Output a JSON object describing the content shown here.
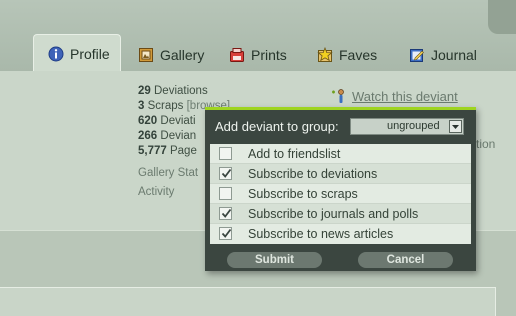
{
  "tabs": [
    {
      "label": "Profile",
      "icon": "info-icon",
      "active": true
    },
    {
      "label": "Gallery",
      "icon": "gallery-icon",
      "active": false
    },
    {
      "label": "Prints",
      "icon": "prints-icon",
      "active": false
    },
    {
      "label": "Faves",
      "icon": "faves-icon",
      "active": false
    },
    {
      "label": "Journal",
      "icon": "journal-icon",
      "active": false
    }
  ],
  "stats": [
    {
      "count": "29",
      "label": "Deviations"
    },
    {
      "count": "3",
      "label": "Scraps",
      "extra": "[browse]"
    },
    {
      "count": "620",
      "label": "Deviati"
    },
    {
      "count": "266",
      "label": "Devian"
    },
    {
      "count": "5,777",
      "label": "Page"
    }
  ],
  "meta": {
    "gallery": "Gallery Stat",
    "activity": "Activity"
  },
  "watch_link": "Watch this deviant",
  "right_partial": "tion",
  "popup": {
    "heading": "Add deviant to group:",
    "group_value": "ungrouped",
    "options": [
      {
        "label": "Add to friendslist",
        "checked": false
      },
      {
        "label": "Subscribe to deviations",
        "checked": true
      },
      {
        "label": "Subscribe to scraps",
        "checked": false
      },
      {
        "label": "Subscribe to journals and polls",
        "checked": true
      },
      {
        "label": "Subscribe to news articles",
        "checked": true
      }
    ],
    "submit": "Submit",
    "cancel": "Cancel"
  },
  "colors": {
    "accent": "#9ed420",
    "popup_bg": "#3b4640",
    "page_bg": "#cad6c9"
  }
}
